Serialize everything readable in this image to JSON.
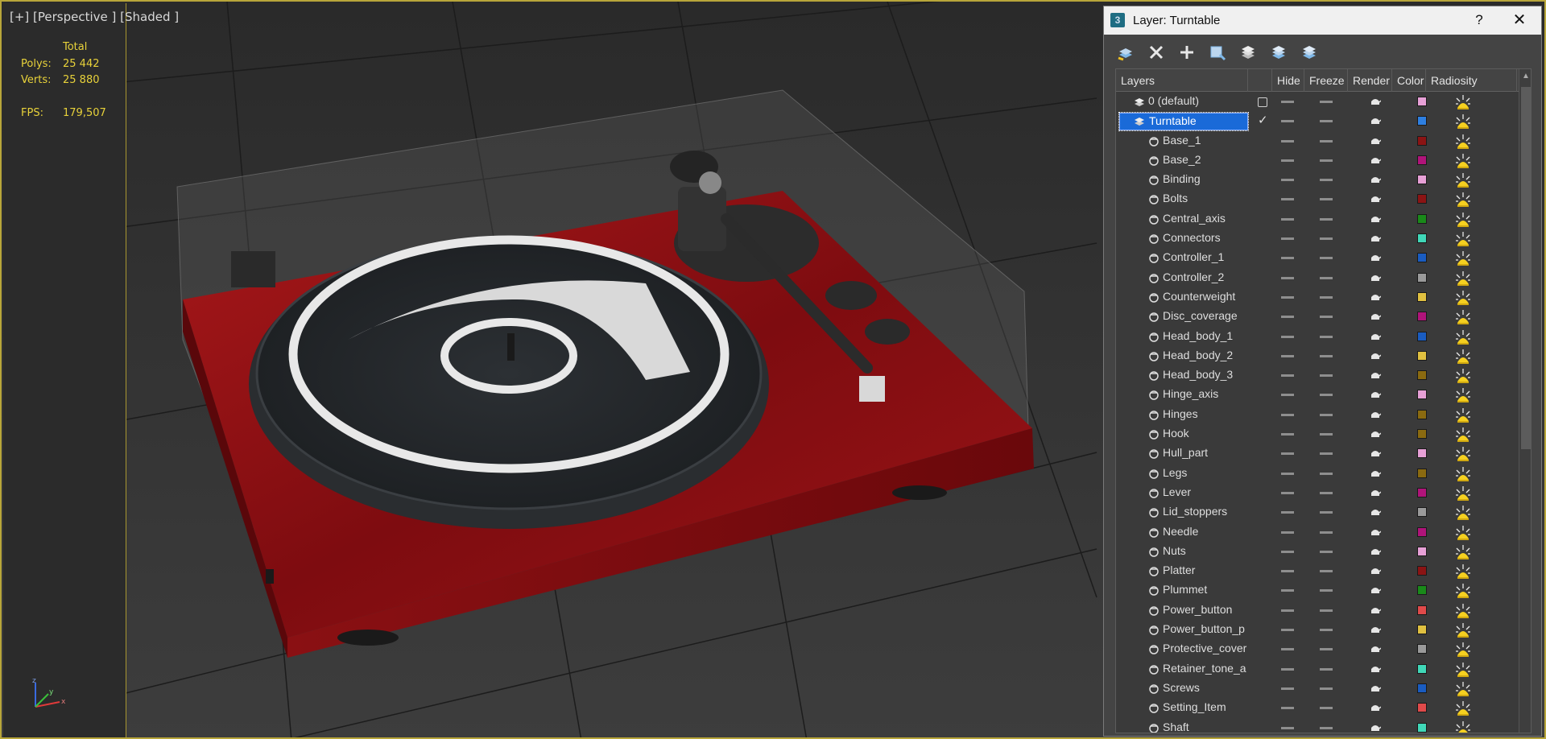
{
  "viewport": {
    "label": "[+] [Perspective ] [Shaded ]",
    "stats": {
      "total_label": "Total",
      "polys_label": "Polys:",
      "polys_value": "25 442",
      "verts_label": "Verts:",
      "verts_value": "25 880",
      "fps_label": "FPS:",
      "fps_value": "179,507"
    },
    "axis": {
      "x": "x",
      "y": "y",
      "z": "z"
    }
  },
  "dialog": {
    "title": "Layer: Turntable",
    "help_label": "?",
    "close_label": "✕",
    "toolbar": [
      {
        "name": "create-new-layer",
        "icon": "stack-plus-icon"
      },
      {
        "name": "delete-layer",
        "icon": "x-icon"
      },
      {
        "name": "add-selected",
        "icon": "plus-icon"
      },
      {
        "name": "select-highlighted",
        "icon": "cube-select-icon"
      },
      {
        "name": "highlight-selected",
        "icon": "layer-highlight-icon"
      },
      {
        "name": "hide-unhide-all",
        "icon": "layers-hide-icon"
      },
      {
        "name": "freeze-unfreeze-all",
        "icon": "layers-freeze-icon"
      }
    ],
    "columns": {
      "layers": "Layers",
      "hide": "Hide",
      "freeze": "Freeze",
      "render": "Render",
      "color": "Color",
      "radiosity": "Radiosity"
    },
    "rows": [
      {
        "name": "0 (default)",
        "kind": "layer",
        "current": "box",
        "color": "#e7a0d6"
      },
      {
        "name": "Turntable",
        "kind": "layer",
        "current": "check",
        "selected": true,
        "expanded": true,
        "color": "#2e7fe0"
      },
      {
        "name": "Base_1",
        "kind": "object",
        "color": "#8b1414"
      },
      {
        "name": "Base_2",
        "kind": "object",
        "color": "#b0147a"
      },
      {
        "name": "Binding",
        "kind": "object",
        "color": "#e7a0d6"
      },
      {
        "name": "Bolts",
        "kind": "object",
        "color": "#8b1414"
      },
      {
        "name": "Central_axis",
        "kind": "object",
        "color": "#1a8a1a"
      },
      {
        "name": "Connectors",
        "kind": "object",
        "color": "#40d8b8"
      },
      {
        "name": "Controller_1",
        "kind": "object",
        "color": "#1a5cc0"
      },
      {
        "name": "Controller_2",
        "kind": "object",
        "color": "#9a9a9a"
      },
      {
        "name": "Counterweight",
        "kind": "object",
        "color": "#e0c040"
      },
      {
        "name": "Disc_coverage",
        "kind": "object",
        "color": "#b0147a"
      },
      {
        "name": "Head_body_1",
        "kind": "object",
        "color": "#1a5cc0"
      },
      {
        "name": "Head_body_2",
        "kind": "object",
        "color": "#e0c040"
      },
      {
        "name": "Head_body_3",
        "kind": "object",
        "color": "#8a6a10"
      },
      {
        "name": "Hinge_axis",
        "kind": "object",
        "color": "#e7a0d6"
      },
      {
        "name": "Hinges",
        "kind": "object",
        "color": "#8a6a10"
      },
      {
        "name": "Hook",
        "kind": "object",
        "color": "#8a6a10"
      },
      {
        "name": "Hull_part",
        "kind": "object",
        "color": "#e7a0d6"
      },
      {
        "name": "Legs",
        "kind": "object",
        "color": "#8a6a10"
      },
      {
        "name": "Lever",
        "kind": "object",
        "color": "#b0147a"
      },
      {
        "name": "Lid_stoppers",
        "kind": "object",
        "color": "#9a9a9a"
      },
      {
        "name": "Needle",
        "kind": "object",
        "color": "#b0147a"
      },
      {
        "name": "Nuts",
        "kind": "object",
        "color": "#e7a0d6"
      },
      {
        "name": "Platter",
        "kind": "object",
        "color": "#8b1414"
      },
      {
        "name": "Plummet",
        "kind": "object",
        "color": "#1a8a1a"
      },
      {
        "name": "Power_button",
        "kind": "object",
        "color": "#e04a4a"
      },
      {
        "name": "Power_button_p",
        "kind": "object",
        "color": "#e0c040"
      },
      {
        "name": "Protective_cover",
        "kind": "object",
        "color": "#9a9a9a"
      },
      {
        "name": "Retainer_tone_a",
        "kind": "object",
        "color": "#40d8b8"
      },
      {
        "name": "Screws",
        "kind": "object",
        "color": "#1a5cc0"
      },
      {
        "name": "Setting_Item",
        "kind": "object",
        "color": "#e04a4a"
      },
      {
        "name": "Shaft",
        "kind": "object",
        "color": "#40d8b8"
      }
    ]
  }
}
